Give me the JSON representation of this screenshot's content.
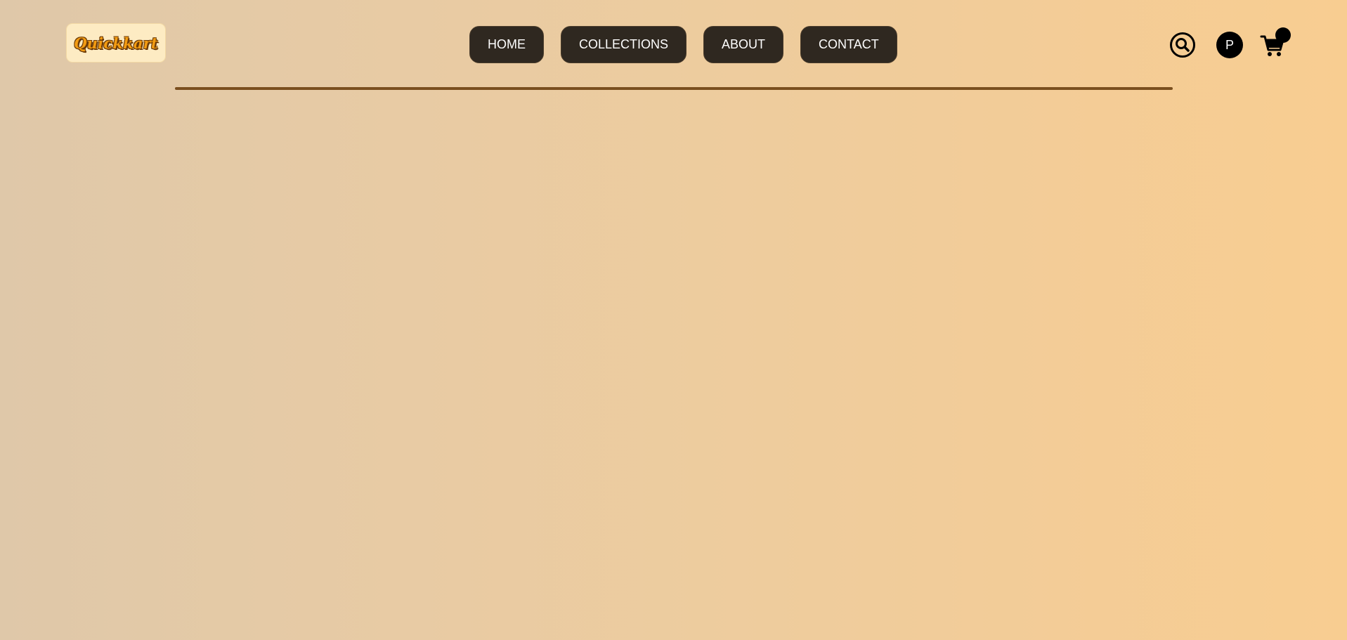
{
  "brand": {
    "logo_text": "Quickkart"
  },
  "nav": {
    "items": [
      {
        "label": "HOME"
      },
      {
        "label": "COLLECTIONS"
      },
      {
        "label": "ABOUT"
      },
      {
        "label": "CONTACT"
      }
    ]
  },
  "header_actions": {
    "search_icon": "search-icon",
    "profile_initial": "P",
    "cart_icon": "cart-icon",
    "cart_badge_count": ""
  },
  "colors": {
    "nav_button_bg": "#2f2820",
    "divider": "#7a4f1f",
    "logo_bg": "#fdebc3",
    "logo_text": "#f29b12",
    "background_start": "#dfc8a9",
    "background_end": "#f8cd91"
  }
}
